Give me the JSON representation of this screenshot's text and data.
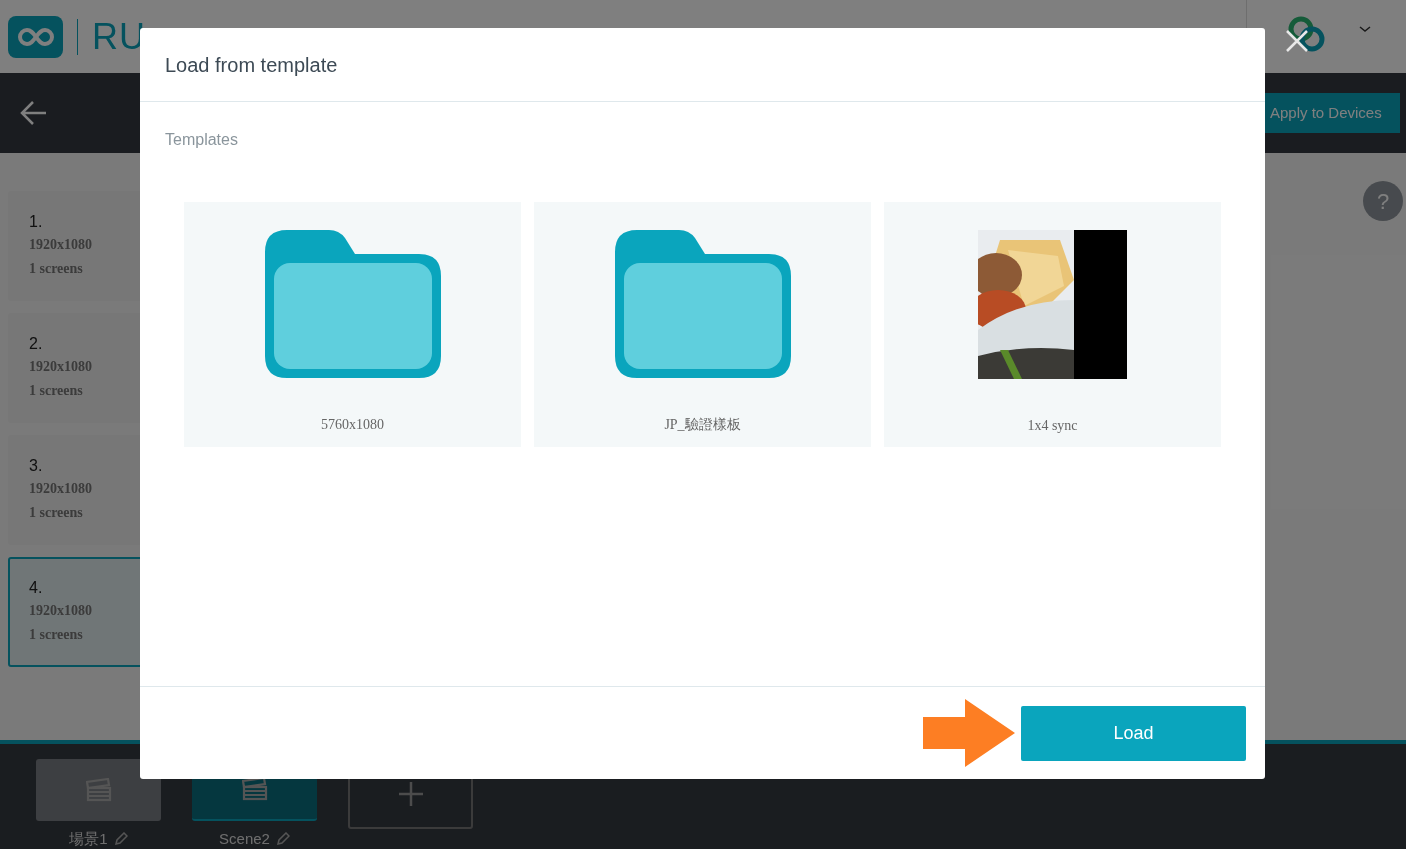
{
  "header": {
    "logo_text": "RU"
  },
  "toolbar": {
    "apply_button": "Apply to Devices",
    "help": "?"
  },
  "layouts": [
    {
      "number": "1.",
      "resolution": "1920x1080",
      "screens": "1 screens",
      "selected": false
    },
    {
      "number": "2.",
      "resolution": "1920x1080",
      "screens": "1 screens",
      "selected": false
    },
    {
      "number": "3.",
      "resolution": "1920x1080",
      "screens": "1 screens",
      "selected": false
    },
    {
      "number": "4.",
      "resolution": "1920x1080",
      "screens": "1 screens",
      "selected": true
    }
  ],
  "scenes": [
    {
      "label": "場景1",
      "selected": false
    },
    {
      "label": "Scene2",
      "selected": true
    }
  ],
  "modal": {
    "title": "Load from template",
    "section_label": "Templates",
    "templates": [
      {
        "kind": "folder",
        "label": "5760x1080"
      },
      {
        "kind": "folder",
        "label": "JP_驗證樣板"
      },
      {
        "kind": "picture",
        "label": "1x4 sync"
      }
    ],
    "load_button": "Load"
  }
}
